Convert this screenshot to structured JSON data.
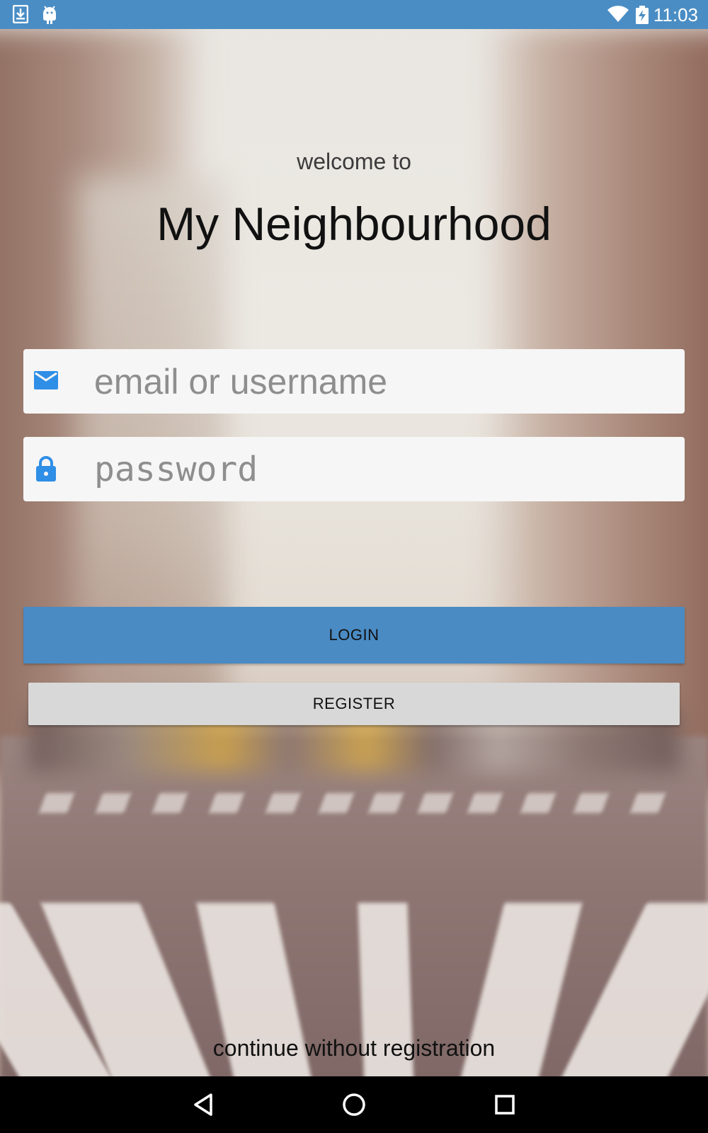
{
  "status_bar": {
    "time": "11:03",
    "left_icons": [
      "download-icon",
      "android-icon"
    ],
    "right_icons": [
      "wifi-icon",
      "battery-charging-icon"
    ]
  },
  "header": {
    "welcome_text": "welcome to",
    "app_title": "My Neighbourhood"
  },
  "form": {
    "email": {
      "placeholder": "email or username",
      "value": "",
      "icon": "envelope-icon"
    },
    "password": {
      "placeholder": "password",
      "value": "",
      "icon": "lock-icon"
    },
    "login_label": "LOGIN",
    "register_label": "REGISTER"
  },
  "footer": {
    "continue_label": "continue without registration"
  },
  "nav_bar": {
    "buttons": [
      "back-icon",
      "home-icon",
      "recents-icon"
    ]
  },
  "colors": {
    "accent": "#4a8bc4",
    "status_bar": "#4a8dc4",
    "field_icon": "#2f8ee6",
    "register_button": "#d8d8d8",
    "field_background": "#f6f6f6"
  }
}
